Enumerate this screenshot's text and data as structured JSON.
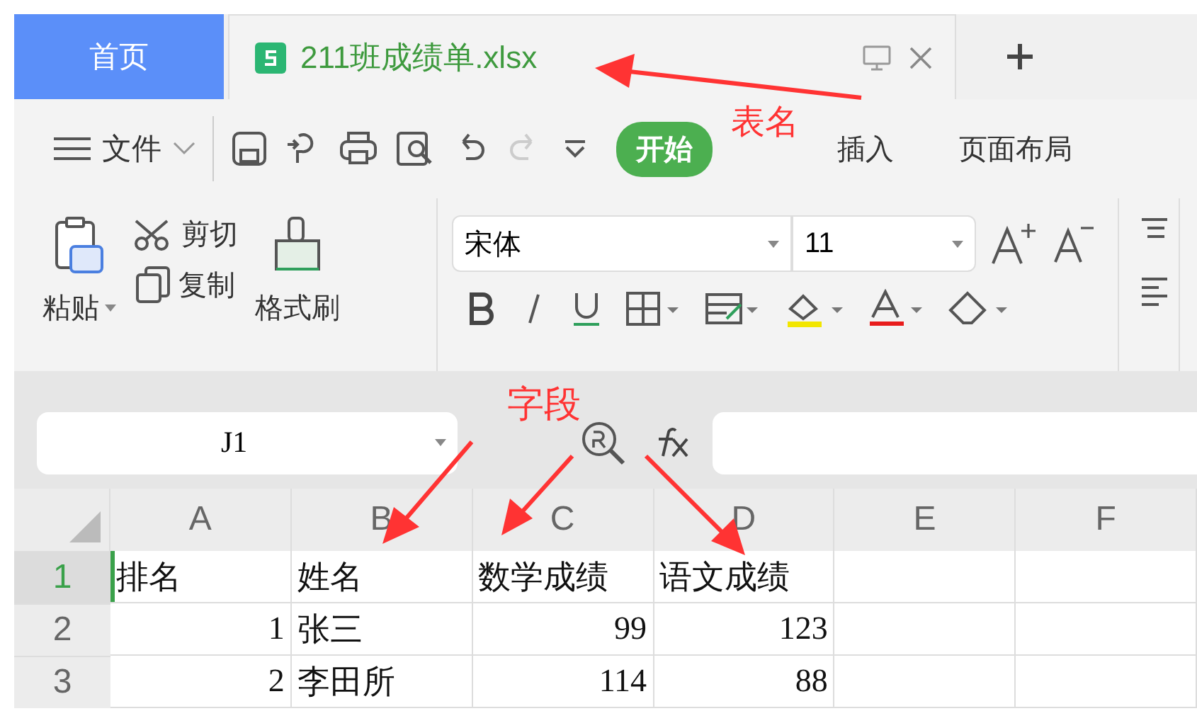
{
  "tabs": [
    {
      "label": "首页",
      "selected": false,
      "kind": "home"
    },
    {
      "label": "211班成绩单.xlsx",
      "selected": true,
      "kind": "document"
    }
  ],
  "toolbar": {
    "menu": "文件",
    "ribbon_tabs": [
      {
        "label": "开始",
        "selected": true
      },
      {
        "label": "插入",
        "selected": false
      },
      {
        "label": "页面布局",
        "selected": false
      }
    ]
  },
  "clipboard": {
    "paste": "粘贴",
    "cut": "剪切",
    "copy": "复制",
    "format_painter": "格式刷"
  },
  "font": {
    "name": "宋体",
    "size": "11"
  },
  "formula_bar": {
    "cell_ref": "J1"
  },
  "columns": [
    "A",
    "B",
    "C",
    "D",
    "E",
    "F"
  ],
  "rows": [
    {
      "number": "1",
      "selected": true,
      "cells": [
        {
          "value": "排名",
          "kind": "text"
        },
        {
          "value": "姓名",
          "kind": "text"
        },
        {
          "value": "数学成绩",
          "kind": "text"
        },
        {
          "value": "语文成绩",
          "kind": "text"
        }
      ]
    },
    {
      "number": "2",
      "selected": false,
      "cells": [
        {
          "value": "1",
          "kind": "number"
        },
        {
          "value": "张三",
          "kind": "text"
        },
        {
          "value": "99",
          "kind": "number"
        },
        {
          "value": "123",
          "kind": "number"
        }
      ]
    },
    {
      "number": "3",
      "selected": false,
      "cells": [
        {
          "value": "2",
          "kind": "number"
        },
        {
          "value": "李田所",
          "kind": "text"
        },
        {
          "value": "114",
          "kind": "number"
        },
        {
          "value": "88",
          "kind": "number"
        }
      ]
    }
  ],
  "annotations": [
    {
      "text": "表名",
      "kind": "sheet-name"
    },
    {
      "text": "字段",
      "kind": "fields"
    }
  ]
}
